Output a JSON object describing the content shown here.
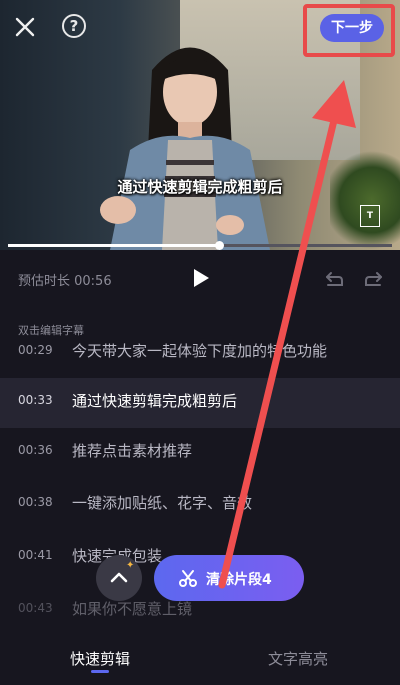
{
  "header": {
    "next_label": "下一步",
    "close_icon": "close-icon",
    "help_icon": "help-icon",
    "help_glyph": "?"
  },
  "video": {
    "subtitle": "通过快速剪辑完成粗剪后",
    "ton_label": "T"
  },
  "playback": {
    "progress": 0.55
  },
  "controls": {
    "estimate": "预估时长 00:56"
  },
  "editor": {
    "hint": "双击编辑字幕",
    "rows": [
      {
        "time": "00:29",
        "text": "今天带大家一起体验下度加的特色功能"
      },
      {
        "time": "00:33",
        "text": "通过快速剪辑完成粗剪后"
      },
      {
        "time": "00:36",
        "text": "推荐点击素材推荐"
      },
      {
        "time": "00:38",
        "text": "一键添加贴纸、花字、音效"
      },
      {
        "time": "00:41",
        "text": "快速完成包装"
      },
      {
        "time": "00:43",
        "text": "如果你不愿意上镜"
      }
    ]
  },
  "actions": {
    "clear_label": "清除片段4"
  },
  "tabs": [
    {
      "label": "快速剪辑"
    },
    {
      "label": "文字高亮"
    }
  ],
  "colors": {
    "accent": "#5c68ef",
    "highlight": "#e84a4a"
  }
}
